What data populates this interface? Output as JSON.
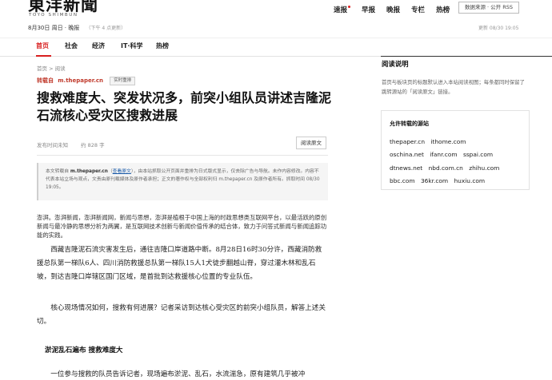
{
  "masthead": {
    "logo": "東洋新聞",
    "logo_sub": "TOYO SHIMBUN",
    "date": "8月30日 周日 · 晚报",
    "date_note": "（下午 4 点更新）",
    "nav": [
      "速报",
      "早报",
      "晚报",
      "专栏",
      "热榜"
    ],
    "source_box": "数据来源 · 公开 RSS",
    "updated": "更新 08/30 19:05"
  },
  "sections": [
    "首页",
    "社会",
    "经济",
    "IT·科学",
    "热榜"
  ],
  "article": {
    "breadcrumb": "首页 > 阅读",
    "repost_label": "转载自",
    "repost_domain": "m.thepaper.cn",
    "repost_tag": "实时重排",
    "headline": "搜救难度大、突发状况多，前突小组队员讲述吉隆泥石流核心受灾区搜救进展",
    "meta_time": "发布时间未知",
    "meta_words": "约 828 字",
    "read_original": "阅读原文",
    "notice": {
      "part1": "本文转载自 ",
      "domain": "m.thepaper.cn",
      "part2": "（",
      "link": "查看原文",
      "part3": "），由本站抓取公开页面并重排为日式版式显示，仅去除广告与导航。未作内容修改。内容不代表本站立场与观点，文责由原刊载媒体及原作者承担；正文的著作权与全部权利归 m.thepaper.cn 及原作者所有。抓取时间 08/30 19:05。"
    },
    "summary": "澎湃。澎湃新闻，澎湃新闻网，新闻与思想，澎湃是植根于中国上海的时政思想类互联网平台，以最活跃的原创新闻与最冷静的思想分析为两翼，是互联网技术创新与新闻价值传承的结合体，致力于问答式新闻与新闻追踪功能的实践。",
    "p1": "西藏吉隆泥石流灾害发生后，通往吉隆口岸道路中断。8月28日16时30分许，西藏消防救援总队第一梯队6人、四川消防救援总队第一梯队15人1犬徒步翻越山脊，穿过灌木林和乱石坡，到达吉隆口岸辖区国门区域，是首批到达救援核心位置的专业队伍。",
    "p2": "核心现场情况如何，搜救有何进展？记者采访到达核心受灾区的前突小组队员，解答上述关切。",
    "subhead": "淤泥乱石遍布 搜救难度大",
    "p3": "一位参与搜救的队员告诉记者，现场遍布淤泥、乱石，水流湍急，原有建筑几乎被冲"
  },
  "sidebar": {
    "title": "阅读说明",
    "desc": "首页与板块页的标题默认进入本站阅读视图；每条都同时保留了跳转源站的「阅读原文」链接。",
    "card_title": "允许转载的源站",
    "rows": [
      [
        "thepaper.cn",
        "ithome.com"
      ],
      [
        "oschina.net",
        "ifanr.com",
        "sspai.com"
      ],
      [
        "dtnews.net",
        "nbd.com.cn",
        "zhihu.com"
      ],
      [
        "bbc.com",
        "36kr.com",
        "huxiu.com"
      ]
    ]
  }
}
